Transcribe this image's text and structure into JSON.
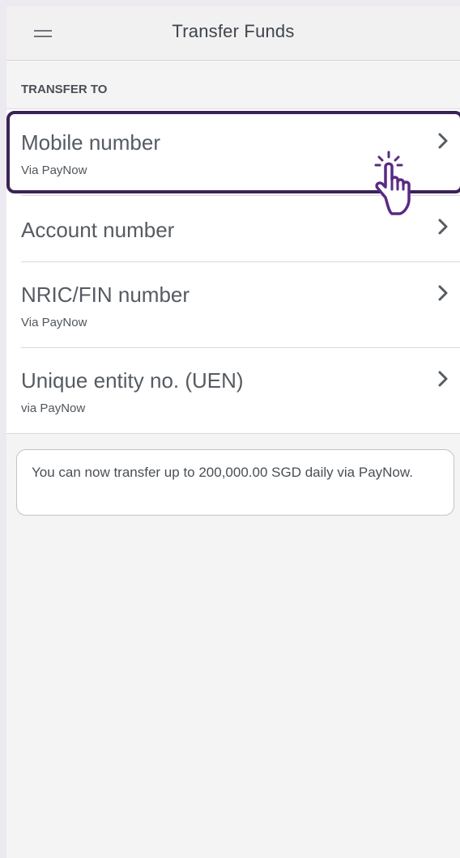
{
  "header": {
    "title": "Transfer Funds",
    "menu_icon": "hamburger-menu-icon"
  },
  "section": {
    "title": "TRANSFER TO"
  },
  "options": [
    {
      "label": "Mobile number",
      "sub": "Via PayNow",
      "icon": "chevron-right-icon",
      "highlighted": true
    },
    {
      "label": "Account number",
      "sub": "",
      "icon": "chevron-right-icon"
    },
    {
      "label": "NRIC/FIN number",
      "sub": "Via PayNow",
      "icon": "chevron-right-icon"
    },
    {
      "label": "Unique entity no. (UEN)",
      "sub": "via PayNow",
      "icon": "chevron-right-icon"
    }
  ],
  "info": {
    "text": "You can now transfer up to 200,000.00 SGD daily via PayNow."
  },
  "colors": {
    "highlight": "#3a2257",
    "background": "#f4f4f4",
    "card": "#ffffff",
    "hand_cursor": "#5a2a82"
  }
}
